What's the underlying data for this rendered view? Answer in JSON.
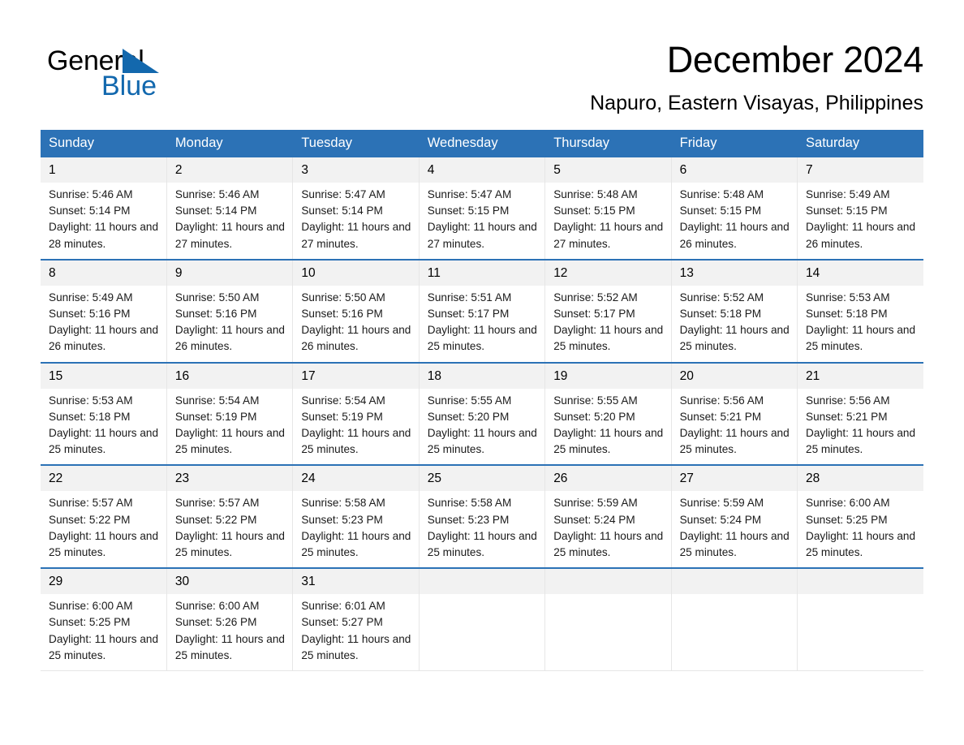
{
  "brand": {
    "name_line1": "General",
    "name_line2": "Blue",
    "triangle_color": "#1368ad",
    "text_color": "#000000",
    "blue_text_color": "#1268ae"
  },
  "header": {
    "title": "December 2024",
    "subtitle": "Napuro, Eastern Visayas, Philippines"
  },
  "colors": {
    "header_blue": "#2c72b6",
    "row_separator_blue": "#2c72b6",
    "daynum_background": "#f2f2f2",
    "cell_border": "#e6e6e6"
  },
  "calendar": {
    "weekday_headers": [
      "Sunday",
      "Monday",
      "Tuesday",
      "Wednesday",
      "Thursday",
      "Friday",
      "Saturday"
    ],
    "weeks": [
      [
        {
          "day": "1",
          "sunrise": "Sunrise: 5:46 AM",
          "sunset": "Sunset: 5:14 PM",
          "daylight": "Daylight: 11 hours and 28 minutes."
        },
        {
          "day": "2",
          "sunrise": "Sunrise: 5:46 AM",
          "sunset": "Sunset: 5:14 PM",
          "daylight": "Daylight: 11 hours and 27 minutes."
        },
        {
          "day": "3",
          "sunrise": "Sunrise: 5:47 AM",
          "sunset": "Sunset: 5:14 PM",
          "daylight": "Daylight: 11 hours and 27 minutes."
        },
        {
          "day": "4",
          "sunrise": "Sunrise: 5:47 AM",
          "sunset": "Sunset: 5:15 PM",
          "daylight": "Daylight: 11 hours and 27 minutes."
        },
        {
          "day": "5",
          "sunrise": "Sunrise: 5:48 AM",
          "sunset": "Sunset: 5:15 PM",
          "daylight": "Daylight: 11 hours and 27 minutes."
        },
        {
          "day": "6",
          "sunrise": "Sunrise: 5:48 AM",
          "sunset": "Sunset: 5:15 PM",
          "daylight": "Daylight: 11 hours and 26 minutes."
        },
        {
          "day": "7",
          "sunrise": "Sunrise: 5:49 AM",
          "sunset": "Sunset: 5:15 PM",
          "daylight": "Daylight: 11 hours and 26 minutes."
        }
      ],
      [
        {
          "day": "8",
          "sunrise": "Sunrise: 5:49 AM",
          "sunset": "Sunset: 5:16 PM",
          "daylight": "Daylight: 11 hours and 26 minutes."
        },
        {
          "day": "9",
          "sunrise": "Sunrise: 5:50 AM",
          "sunset": "Sunset: 5:16 PM",
          "daylight": "Daylight: 11 hours and 26 minutes."
        },
        {
          "day": "10",
          "sunrise": "Sunrise: 5:50 AM",
          "sunset": "Sunset: 5:16 PM",
          "daylight": "Daylight: 11 hours and 26 minutes."
        },
        {
          "day": "11",
          "sunrise": "Sunrise: 5:51 AM",
          "sunset": "Sunset: 5:17 PM",
          "daylight": "Daylight: 11 hours and 25 minutes."
        },
        {
          "day": "12",
          "sunrise": "Sunrise: 5:52 AM",
          "sunset": "Sunset: 5:17 PM",
          "daylight": "Daylight: 11 hours and 25 minutes."
        },
        {
          "day": "13",
          "sunrise": "Sunrise: 5:52 AM",
          "sunset": "Sunset: 5:18 PM",
          "daylight": "Daylight: 11 hours and 25 minutes."
        },
        {
          "day": "14",
          "sunrise": "Sunrise: 5:53 AM",
          "sunset": "Sunset: 5:18 PM",
          "daylight": "Daylight: 11 hours and 25 minutes."
        }
      ],
      [
        {
          "day": "15",
          "sunrise": "Sunrise: 5:53 AM",
          "sunset": "Sunset: 5:18 PM",
          "daylight": "Daylight: 11 hours and 25 minutes."
        },
        {
          "day": "16",
          "sunrise": "Sunrise: 5:54 AM",
          "sunset": "Sunset: 5:19 PM",
          "daylight": "Daylight: 11 hours and 25 minutes."
        },
        {
          "day": "17",
          "sunrise": "Sunrise: 5:54 AM",
          "sunset": "Sunset: 5:19 PM",
          "daylight": "Daylight: 11 hours and 25 minutes."
        },
        {
          "day": "18",
          "sunrise": "Sunrise: 5:55 AM",
          "sunset": "Sunset: 5:20 PM",
          "daylight": "Daylight: 11 hours and 25 minutes."
        },
        {
          "day": "19",
          "sunrise": "Sunrise: 5:55 AM",
          "sunset": "Sunset: 5:20 PM",
          "daylight": "Daylight: 11 hours and 25 minutes."
        },
        {
          "day": "20",
          "sunrise": "Sunrise: 5:56 AM",
          "sunset": "Sunset: 5:21 PM",
          "daylight": "Daylight: 11 hours and 25 minutes."
        },
        {
          "day": "21",
          "sunrise": "Sunrise: 5:56 AM",
          "sunset": "Sunset: 5:21 PM",
          "daylight": "Daylight: 11 hours and 25 minutes."
        }
      ],
      [
        {
          "day": "22",
          "sunrise": "Sunrise: 5:57 AM",
          "sunset": "Sunset: 5:22 PM",
          "daylight": "Daylight: 11 hours and 25 minutes."
        },
        {
          "day": "23",
          "sunrise": "Sunrise: 5:57 AM",
          "sunset": "Sunset: 5:22 PM",
          "daylight": "Daylight: 11 hours and 25 minutes."
        },
        {
          "day": "24",
          "sunrise": "Sunrise: 5:58 AM",
          "sunset": "Sunset: 5:23 PM",
          "daylight": "Daylight: 11 hours and 25 minutes."
        },
        {
          "day": "25",
          "sunrise": "Sunrise: 5:58 AM",
          "sunset": "Sunset: 5:23 PM",
          "daylight": "Daylight: 11 hours and 25 minutes."
        },
        {
          "day": "26",
          "sunrise": "Sunrise: 5:59 AM",
          "sunset": "Sunset: 5:24 PM",
          "daylight": "Daylight: 11 hours and 25 minutes."
        },
        {
          "day": "27",
          "sunrise": "Sunrise: 5:59 AM",
          "sunset": "Sunset: 5:24 PM",
          "daylight": "Daylight: 11 hours and 25 minutes."
        },
        {
          "day": "28",
          "sunrise": "Sunrise: 6:00 AM",
          "sunset": "Sunset: 5:25 PM",
          "daylight": "Daylight: 11 hours and 25 minutes."
        }
      ],
      [
        {
          "day": "29",
          "sunrise": "Sunrise: 6:00 AM",
          "sunset": "Sunset: 5:25 PM",
          "daylight": "Daylight: 11 hours and 25 minutes."
        },
        {
          "day": "30",
          "sunrise": "Sunrise: 6:00 AM",
          "sunset": "Sunset: 5:26 PM",
          "daylight": "Daylight: 11 hours and 25 minutes."
        },
        {
          "day": "31",
          "sunrise": "Sunrise: 6:01 AM",
          "sunset": "Sunset: 5:27 PM",
          "daylight": "Daylight: 11 hours and 25 minutes."
        },
        {
          "day": "",
          "sunrise": "",
          "sunset": "",
          "daylight": ""
        },
        {
          "day": "",
          "sunrise": "",
          "sunset": "",
          "daylight": ""
        },
        {
          "day": "",
          "sunrise": "",
          "sunset": "",
          "daylight": ""
        },
        {
          "day": "",
          "sunrise": "",
          "sunset": "",
          "daylight": ""
        }
      ]
    ]
  }
}
